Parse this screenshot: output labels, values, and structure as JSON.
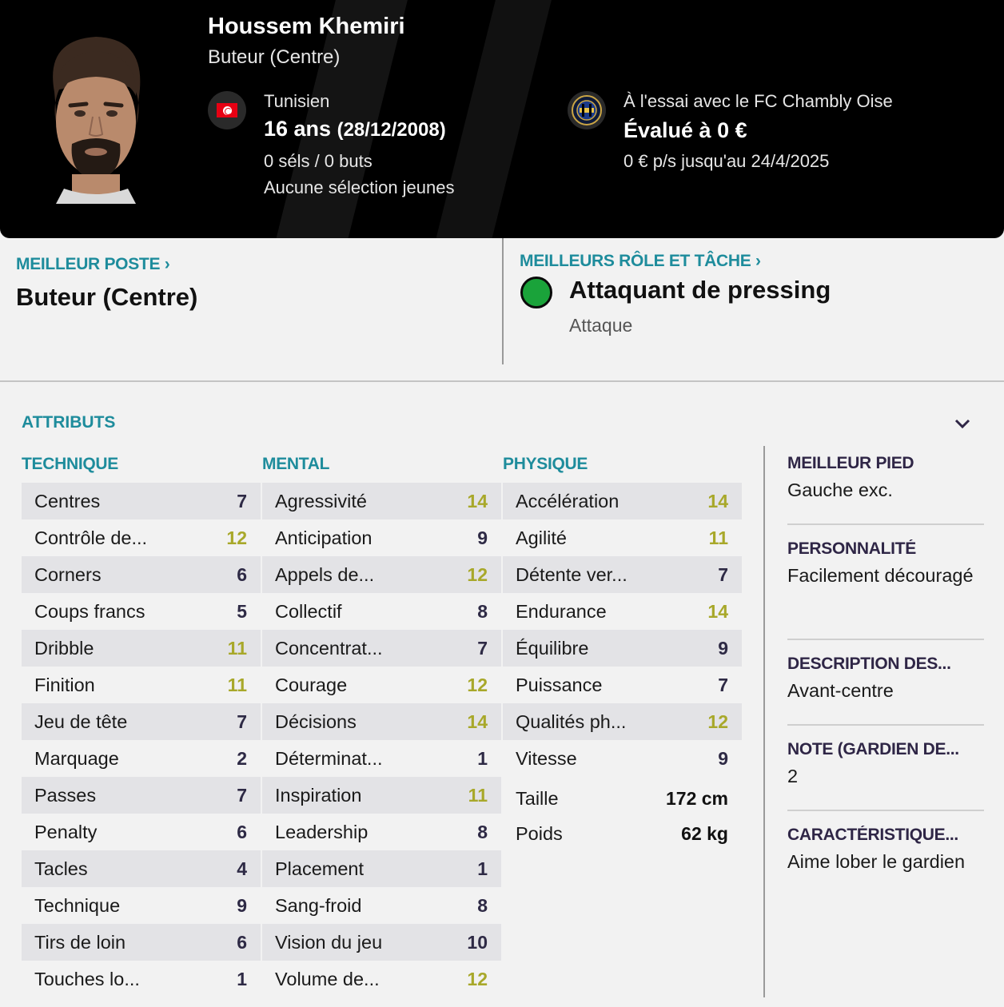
{
  "player": {
    "name": "Houssem Khemiri",
    "position": "Buteur (Centre)",
    "nationality": "Tunisien",
    "age": "16 ans",
    "dob": "(28/12/2008)",
    "caps": "0 séls / 0 buts",
    "youth_caps": "Aucune sélection jeunes",
    "club_status": "À l'essai avec le FC Chambly Oise",
    "value": "Évalué à 0 €",
    "contract": "0 € p/s jusqu'au 24/4/2025",
    "flag_icon": "tunisia-flag-icon",
    "club_icon": "fc-chambly-oise-badge-icon"
  },
  "best_position": {
    "label": "MEILLEUR POSTE",
    "chevron": "›",
    "value": "Buteur (Centre)"
  },
  "best_role": {
    "label": "MEILLEURS RÔLE ET TÂCHE",
    "chevron": "›",
    "role": "Attaquant de pressing",
    "duty": "Attaque",
    "indicator_color": "#1aa33a"
  },
  "attributes": {
    "title": "ATTRIBUTS",
    "technical": {
      "title": "TECHNIQUE",
      "rows": [
        {
          "name": "Centres",
          "value": "7"
        },
        {
          "name": "Contrôle de...",
          "value": "12"
        },
        {
          "name": "Corners",
          "value": "6"
        },
        {
          "name": "Coups francs",
          "value": "5"
        },
        {
          "name": "Dribble",
          "value": "11"
        },
        {
          "name": "Finition",
          "value": "11"
        },
        {
          "name": "Jeu de tête",
          "value": "7"
        },
        {
          "name": "Marquage",
          "value": "2"
        },
        {
          "name": "Passes",
          "value": "7"
        },
        {
          "name": "Penalty",
          "value": "6"
        },
        {
          "name": "Tacles",
          "value": "4"
        },
        {
          "name": "Technique",
          "value": "9"
        },
        {
          "name": "Tirs de loin",
          "value": "6"
        },
        {
          "name": "Touches lo...",
          "value": "1"
        }
      ]
    },
    "mental": {
      "title": "MENTAL",
      "rows": [
        {
          "name": "Agressivité",
          "value": "14"
        },
        {
          "name": "Anticipation",
          "value": "9"
        },
        {
          "name": "Appels de...",
          "value": "12"
        },
        {
          "name": "Collectif",
          "value": "8"
        },
        {
          "name": "Concentrat...",
          "value": "7"
        },
        {
          "name": "Courage",
          "value": "12"
        },
        {
          "name": "Décisions",
          "value": "14"
        },
        {
          "name": "Déterminat...",
          "value": "1"
        },
        {
          "name": "Inspiration",
          "value": "11"
        },
        {
          "name": "Leadership",
          "value": "8"
        },
        {
          "name": "Placement",
          "value": "1"
        },
        {
          "name": "Sang-froid",
          "value": "8"
        },
        {
          "name": "Vision du jeu",
          "value": "10"
        },
        {
          "name": "Volume de...",
          "value": "12"
        }
      ]
    },
    "physical": {
      "title": "PHYSIQUE",
      "rows": [
        {
          "name": "Accélération",
          "value": "14"
        },
        {
          "name": "Agilité",
          "value": "11"
        },
        {
          "name": "Détente ver...",
          "value": "7"
        },
        {
          "name": "Endurance",
          "value": "14"
        },
        {
          "name": "Équilibre",
          "value": "9"
        },
        {
          "name": "Puissance",
          "value": "7"
        },
        {
          "name": "Qualités ph...",
          "value": "12"
        },
        {
          "name": "Vitesse",
          "value": "9"
        }
      ],
      "height_label": "Taille",
      "height_value": "172 cm",
      "weight_label": "Poids",
      "weight_value": "62 kg"
    }
  },
  "info": {
    "foot_label": "MEILLEUR PIED",
    "foot_value": "Gauche exc.",
    "personality_label": "PERSONNALITÉ",
    "personality_value": "Facilement découragé",
    "media_label": "DESCRIPTION DES...",
    "media_value": "Avant-centre",
    "gk_label": "NOTE (GARDIEN DE...",
    "gk_value": "2",
    "traits_label": "CARACTÉRISTIQUE...",
    "traits_value": "Aime lober le gardien"
  },
  "colors": {
    "accent": "#1e8c9c",
    "value_low": "#2e2a45",
    "value_mid": "#a8a82a",
    "header_bg": "#000000"
  }
}
